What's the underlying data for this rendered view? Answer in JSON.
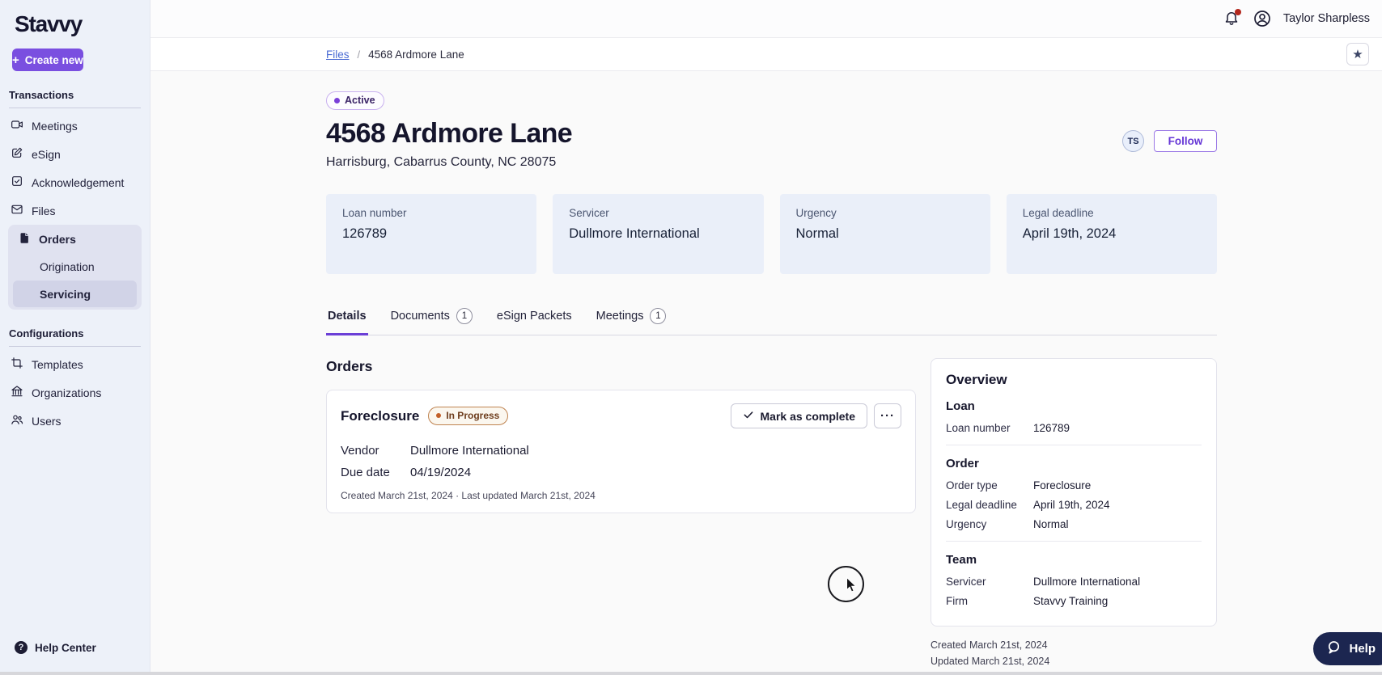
{
  "colors": {
    "accent_purple": "#7a4fe0",
    "tab_underline": "#6b3fd6",
    "link_blue": "#4a6bd4",
    "sidebar_bg": "#edf1f9",
    "card_bg": "#eaeff9",
    "progress_orange": "#c2602a",
    "notification_red": "#b3271d",
    "help_navy": "#1c2650"
  },
  "icons": {
    "plus": "+",
    "star": "★",
    "help_q": "?",
    "more": "···"
  },
  "sidebar": {
    "logo": "Stavvy",
    "create_new_label": "Create new",
    "transactions_label": "Transactions",
    "items": [
      {
        "label": "Meetings"
      },
      {
        "label": "eSign"
      },
      {
        "label": "Acknowledgement"
      },
      {
        "label": "Files"
      },
      {
        "label": "Orders"
      },
      {
        "label": "Origination"
      },
      {
        "label": "Servicing"
      }
    ],
    "configurations_label": "Configurations",
    "config_items": [
      {
        "label": "Templates"
      },
      {
        "label": "Organizations"
      },
      {
        "label": "Users"
      }
    ],
    "help_label": "Help Center"
  },
  "topbar": {
    "user_name": "Taylor Sharpless"
  },
  "breadcrumb": {
    "parent": "Files",
    "separator": "/",
    "current": "4568 Ardmore Lane"
  },
  "hero": {
    "status_badge": "Active",
    "title": "4568 Ardmore Lane",
    "subtitle": "Harrisburg, Cabarrus County, NC 28075",
    "avatar_initials": "TS",
    "follow_label": "Follow"
  },
  "info_cards": [
    {
      "label": "Loan number",
      "value": "126789"
    },
    {
      "label": "Servicer",
      "value": "Dullmore International"
    },
    {
      "label": "Urgency",
      "value": "Normal"
    },
    {
      "label": "Legal deadline",
      "value": "April 19th, 2024"
    }
  ],
  "tabs": [
    {
      "label": "Details"
    },
    {
      "label": "Documents",
      "badge": "1"
    },
    {
      "label": "eSign Packets"
    },
    {
      "label": "Meetings",
      "badge": "1"
    }
  ],
  "orders_section": {
    "heading": "Orders",
    "order": {
      "name": "Foreclosure",
      "status": "In Progress",
      "mark_complete_label": "Mark as complete",
      "vendor_label": "Vendor",
      "vendor_value": "Dullmore International",
      "due_label": "Due date",
      "due_value": "04/19/2024",
      "meta": "Created March 21st, 2024 · Last updated March 21st, 2024"
    }
  },
  "overview": {
    "heading": "Overview",
    "sections": [
      {
        "title": "Loan",
        "rows": [
          {
            "label": "Loan number",
            "value": "126789"
          }
        ]
      },
      {
        "title": "Order",
        "rows": [
          {
            "label": "Order type",
            "value": "Foreclosure"
          },
          {
            "label": "Legal deadline",
            "value": "April 19th, 2024"
          },
          {
            "label": "Urgency",
            "value": "Normal"
          }
        ]
      },
      {
        "title": "Team",
        "rows": [
          {
            "label": "Servicer",
            "value": "Dullmore International"
          },
          {
            "label": "Firm",
            "value": "Stavvy Training"
          }
        ]
      }
    ],
    "created": "Created March 21st, 2024",
    "updated": "Updated March 21st, 2024"
  },
  "help_button_label": "Help"
}
